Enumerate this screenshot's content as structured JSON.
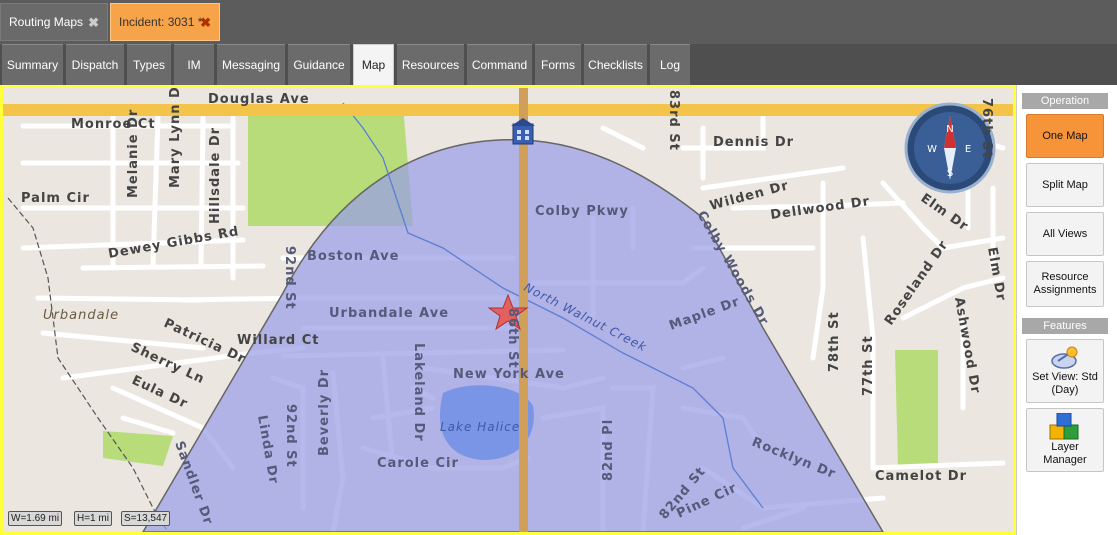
{
  "doc_tabs": [
    {
      "label": "Routing Maps",
      "close": "✖"
    },
    {
      "label": "Incident: 3031 *",
      "close": "✖"
    }
  ],
  "nav_tabs": [
    "Summary",
    "Dispatch",
    "Types",
    "IM",
    "Messaging",
    "Guidance",
    "Map",
    "Resources",
    "Command",
    "Forms",
    "Checklists",
    "Log"
  ],
  "active_nav_tab": "Map",
  "map": {
    "streets": {
      "douglas": "Douglas Ave",
      "monroe": "Monroe Ct",
      "palm": "Palm Cir",
      "melanie": "Melanie Dr",
      "mary_lynn": "Mary Lynn Dr",
      "hillsdale": "Hillsdale Dr",
      "dewey": "Dewey Gibbs Rd",
      "boston": "Boston Ave",
      "st92": "92nd St",
      "colby_pkwy": "Colby Pkwy",
      "urbandale_ave": "Urbandale Ave",
      "st86": "86th St",
      "willard": "Willard Ct",
      "patricia": "Patricia Dr",
      "sherry": "Sherry Ln",
      "eula": "Eula Dr",
      "sandler": "Sandler Dr",
      "linda": "Linda Dr",
      "st92b": "92nd St",
      "beverly": "Beverly Dr",
      "lakeland": "Lakeland Dr",
      "new_york": "New York Ave",
      "carole": "Carole Cir",
      "pl82": "82nd Pl",
      "st82": "82nd St",
      "pine": "Pine Cir",
      "rocklyn": "Rocklyn Dr",
      "camelot": "Camelot Dr",
      "maple": "Maple Dr",
      "colby_woods": "Colby Woods Dr",
      "st78": "78th St",
      "st77": "77th St",
      "ashwood": "Ashwood Dr",
      "roseland": "Roseland Dr",
      "elm1": "Elm Dr",
      "elm2": "Elm Dr",
      "dellwood": "Dellwood Dr",
      "wilden": "Wilden Dr",
      "dennis": "Dennis Dr",
      "st83": "83rd St",
      "st76": "76th St"
    },
    "town": "Urbandale",
    "creek": "North Walnut Creek",
    "lake": "Lake Halice",
    "compass_letters": {
      "n": "N",
      "e": "E",
      "s": "S",
      "w": "W"
    },
    "status": {
      "width": "W=1.69 mi",
      "height": "H=1 mi",
      "scale": "S=13,547"
    }
  },
  "panel": {
    "operation_header": "Operation",
    "buttons": [
      {
        "label": "One Map",
        "active": true
      },
      {
        "label": "Split Map",
        "active": false
      },
      {
        "label": "All Views",
        "active": false
      },
      {
        "label_lines": [
          "Resource",
          "Assignments"
        ],
        "active": false
      }
    ],
    "features_header": "Features",
    "features": [
      {
        "label_lines": [
          "Set View: Std",
          "(Day)"
        ],
        "icon": "satellite-dish-icon"
      },
      {
        "label_lines": [
          "Layer",
          "Manager"
        ],
        "icon": "layer-cubes-icon"
      }
    ]
  },
  "colors": {
    "accent_tab": "#f7a34a",
    "active_button": "#f7943a",
    "map_border": "#ffff3a",
    "coverage": "#9a9ee6",
    "highway": "#f3c34a"
  }
}
